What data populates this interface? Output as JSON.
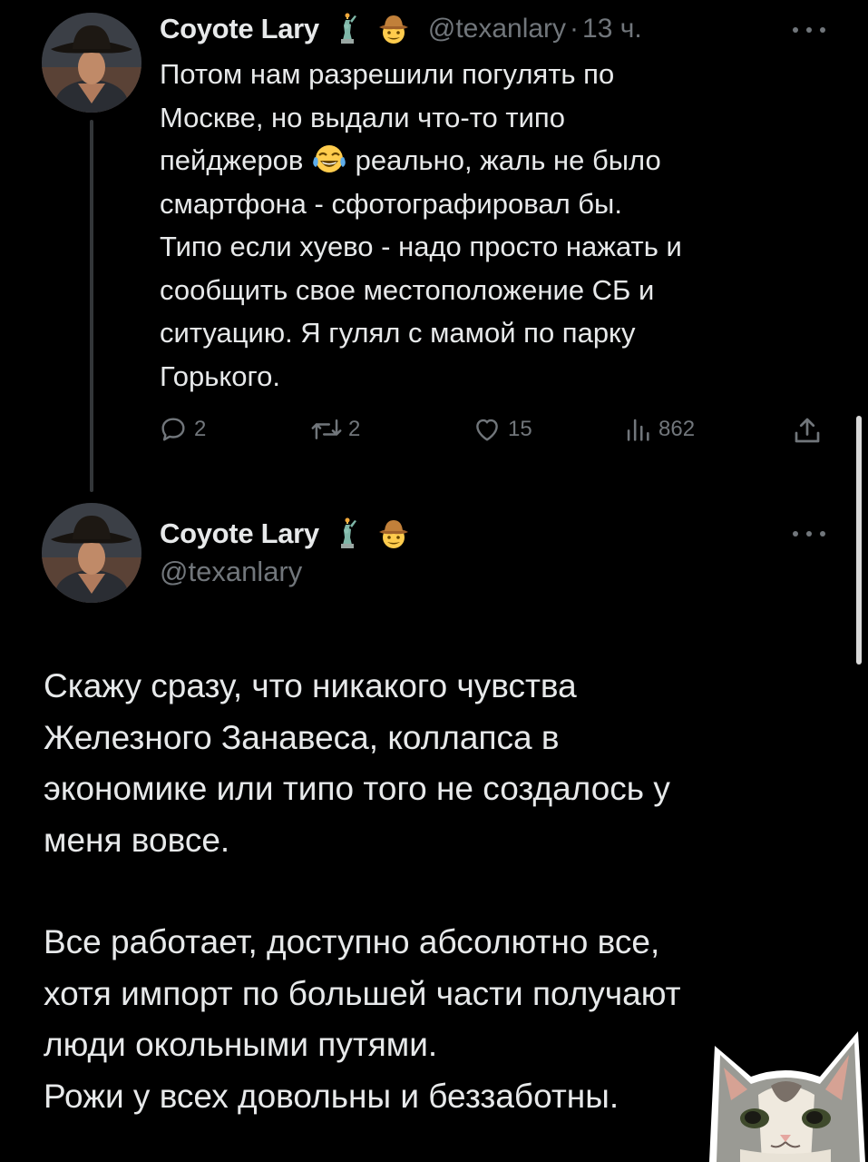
{
  "tweet1": {
    "display_name": "Coyote Lary",
    "badge_icons": [
      "statue-of-liberty-emoji",
      "cowboy-hat-face-emoji"
    ],
    "handle": "@texanlary",
    "separator": "·",
    "time": "13 ч.",
    "text_lines": [
      "Потом нам разрешили погулять по",
      "Москве, но выдали что-то типо",
      "пейджеров",
      "реально, жаль не было",
      "смартфона - сфотографировал бы.",
      "Типо если хуево - надо просто нажать и",
      "сообщить свое местоположение СБ и",
      "ситуацию. Я гулял с мамой по парку",
      "Горького."
    ],
    "inline_emoji": "laughing-crying-emoji",
    "actions": {
      "replies": "2",
      "reposts": "2",
      "likes": "15",
      "views": "862"
    }
  },
  "tweet2": {
    "display_name": "Coyote Lary",
    "badge_icons": [
      "statue-of-liberty-emoji",
      "cowboy-hat-face-emoji"
    ],
    "handle": "@texanlary",
    "paragraph1": [
      "Скажу сразу, что никакого чувства",
      "Железного Занавеса, коллапса в",
      "экономике или типо того не создалось у",
      "меня вовсе."
    ],
    "paragraph2": [
      "Все работает, доступно абсолютно все,",
      "хотя импорт по большей части получают",
      "люди окольными путями.",
      "Рожи у всех довольны и беззаботны."
    ]
  },
  "colors": {
    "background": "#000000",
    "text_primary": "#e7e9ea",
    "text_secondary": "#71767b",
    "thread_line": "#333639"
  }
}
